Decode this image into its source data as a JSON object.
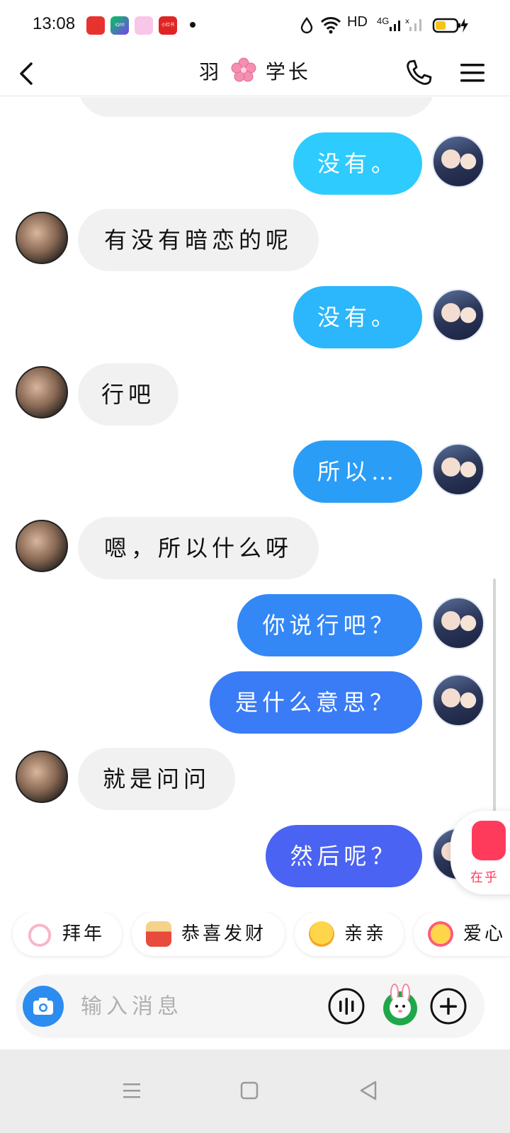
{
  "status_bar": {
    "time": "13:08",
    "network_label": "HD",
    "signal_label": "4G",
    "notif_icons": [
      "video-app-icon",
      "iqiyi-icon",
      "camera-app-icon",
      "shopping-app-icon"
    ],
    "notif_text": [
      "",
      "iQIYI",
      "",
      "小红书"
    ]
  },
  "header": {
    "title_left": "羽",
    "title_right": "学长",
    "title_emoji": "cherry-blossom"
  },
  "messages": [
    {
      "side": "out",
      "text": "没有。"
    },
    {
      "side": "in",
      "text": "有没有暗恋的呢"
    },
    {
      "side": "out",
      "text": "没有。"
    },
    {
      "side": "in",
      "text": "行吧"
    },
    {
      "side": "out",
      "text": "所以…"
    },
    {
      "side": "in",
      "text": "嗯，所以什么呀"
    },
    {
      "side": "out",
      "text": "你说行吧？"
    },
    {
      "side": "out",
      "text": "是什么意思？"
    },
    {
      "side": "in",
      "text": "就是问问"
    },
    {
      "side": "out",
      "text": "然后呢？"
    }
  ],
  "floater": {
    "label": "在乎"
  },
  "quick_replies": [
    {
      "label": "拜年",
      "icon": "rabbit-emoji"
    },
    {
      "label": "恭喜发财",
      "icon": "red-envelope-emoji"
    },
    {
      "label": "亲亲",
      "icon": "hug-emoji"
    },
    {
      "label": "爱心",
      "icon": "love-face-emoji"
    }
  ],
  "input": {
    "placeholder": "输入消息"
  },
  "colors": {
    "bubble_in": "#f1f1f1",
    "bubble_out_gradient": [
      "#2ecbff",
      "#2a9df7",
      "#3a7bf6",
      "#4a63f2"
    ],
    "accent": "#2d8cf0",
    "nav_bar": "#ececec"
  }
}
